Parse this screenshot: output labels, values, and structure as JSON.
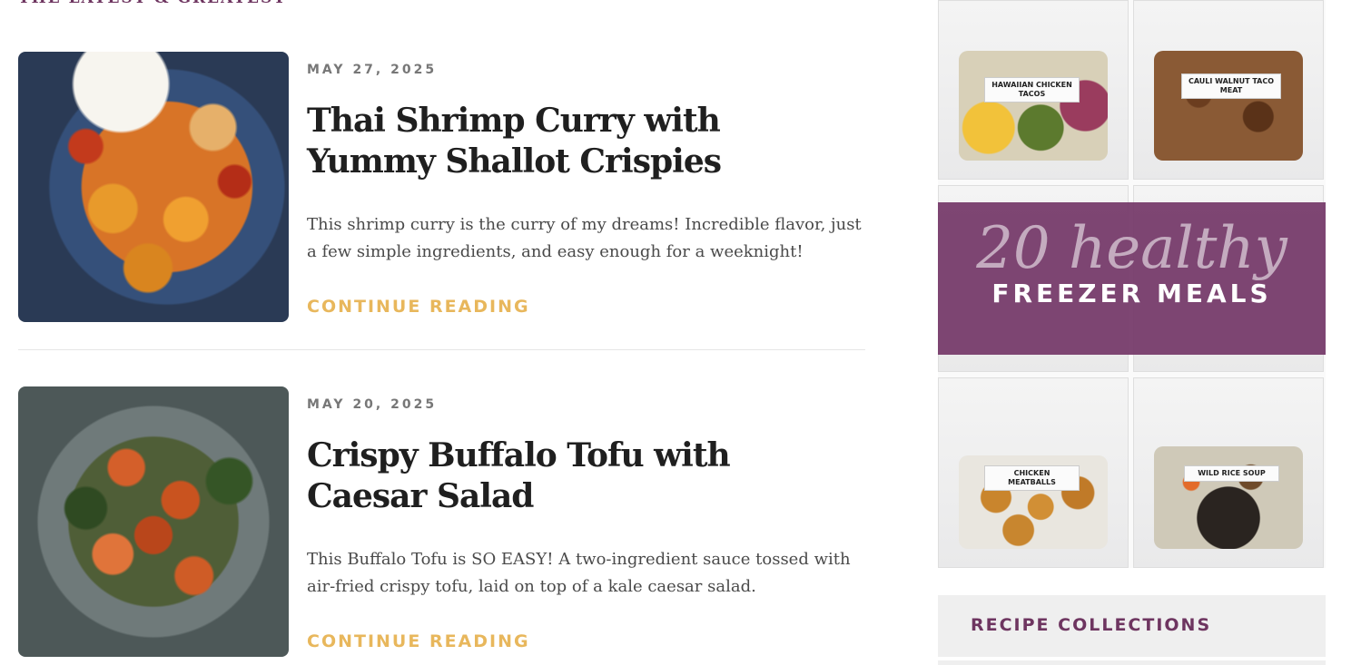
{
  "section": {
    "heading": "THE LATEST & GREATEST"
  },
  "posts": [
    {
      "date": "MAY 27, 2025",
      "title": "Thai Shrimp Curry with Yummy Shallot Crispies",
      "excerpt": "This shrimp curry is the curry of my dreams! Incredible flavor, just a few simple ingredients, and easy enough for a weeknight!",
      "cta": "CONTINUE READING"
    },
    {
      "date": "MAY 20, 2025",
      "title": "Crispy Buffalo Tofu with Caesar Salad",
      "excerpt": "This Buffalo Tofu is SO EASY! A two-ingredient sauce tossed with air-fried crispy tofu, laid on top of a kale caesar salad.",
      "cta": "CONTINUE READING"
    }
  ],
  "sidebar": {
    "promo": {
      "script_text": "20 healthy",
      "title": "FREEZER MEALS",
      "bag_labels": [
        "HAWAIIAN CHICKEN TACOS",
        "CAULI WALNUT TACO MEAT",
        "CHICKEN MEATBALLS",
        "WILD RICE SOUP"
      ]
    },
    "collections": {
      "title": "RECIPE COLLECTIONS"
    }
  },
  "colors": {
    "accent_plum": "#6e3560",
    "cta_gold": "#e8b75c",
    "title_text": "#1f1f1f",
    "body_text": "#4a4a4a",
    "meta_text": "#777777"
  }
}
